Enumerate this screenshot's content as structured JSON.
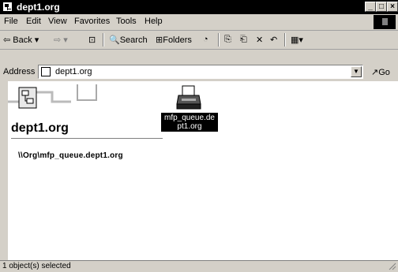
{
  "window": {
    "title": "dept1.org"
  },
  "menu": [
    "File",
    "Edit",
    "View",
    "Favorites",
    "Tools",
    "Help"
  ],
  "toolbar": {
    "back": "Back",
    "search": "Search",
    "folders": "Folders"
  },
  "address": {
    "label": "Address",
    "value": "dept1.org",
    "go": "Go"
  },
  "banner": {
    "title": "dept1.org"
  },
  "location_path": "\\\\Org\\mfp_queue.dept1.org",
  "file": {
    "label_line1": "mfp_queue.de",
    "label_line2": "pt1.org",
    "selected": true
  },
  "status": {
    "text": "1 object(s) selected"
  }
}
